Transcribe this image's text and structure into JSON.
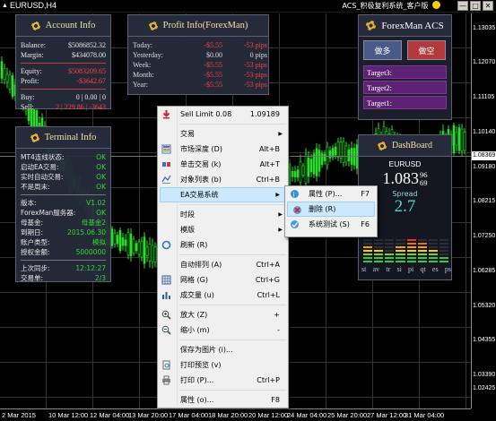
{
  "window": {
    "symbol_tab": "EURUSD,H4",
    "ea_label": "ACS_积极复利系统_客户版",
    "buttons": [
      "—",
      "□",
      "✕"
    ]
  },
  "price_axis": {
    "ticks": [
      "1.13035",
      "1.12070",
      "1.11105",
      "1.10140",
      "1.09180",
      "1.08215",
      "1.07250",
      "1.06285",
      "1.05320",
      "1.04355",
      "1.03390",
      "1.02425"
    ],
    "current": "1.08369"
  },
  "time_axis": {
    "labels": [
      "2 Mar 2015",
      "10 Mar 12:00",
      "12 Mar 04:00",
      "13 Mar 20:00",
      "17 Mar 04:00",
      "18 Mar 20:00",
      "20 Mar 12:00",
      "24 Mar 04:00",
      "25 Mar 20:00",
      "27 Mar 12:00",
      "31 Mar 04:00",
      "1 Apr 12:00",
      "6 Apr 04:00",
      "7 Apr 20:00"
    ]
  },
  "account": {
    "title": "Account Info",
    "rows": [
      {
        "label": "Balance:",
        "value": "$5086852.32"
      },
      {
        "label": "Margin:",
        "value": "$434078.00"
      },
      {
        "label": "Equity:",
        "value": "$5083209.65"
      },
      {
        "label": "Profit:",
        "value": "-$3642.67"
      },
      {
        "label": "Buy:",
        "value": "0 | 0.00 | 0"
      },
      {
        "label": "Sell:",
        "value": "2 | 229.86 | -3643"
      }
    ]
  },
  "profit": {
    "title": "Profit Info(ForexMan)",
    "rows": [
      {
        "label": "Today:",
        "amount": "-$5.55",
        "pips": "-53 pips"
      },
      {
        "label": "Yesterday:",
        "amount": "$0.00",
        "pips": "0 pips"
      },
      {
        "label": "Week:",
        "amount": "-$5.55",
        "pips": "-53 pips"
      },
      {
        "label": "Month:",
        "amount": "-$5.55",
        "pips": "-53 pips"
      },
      {
        "label": "Year:",
        "amount": "-$5.55",
        "pips": "-53 pips"
      }
    ]
  },
  "terminal": {
    "title": "Terminal Info",
    "rows1": [
      {
        "label": "MT4连线状态:",
        "value": "OK"
      },
      {
        "label": "启动EA交易:",
        "value": "OK"
      },
      {
        "label": "实时自动交易:",
        "value": "OK"
      },
      {
        "label": "不是周末:",
        "value": "OK"
      }
    ],
    "rows2": [
      {
        "label": "版本:",
        "value": "V1.02"
      },
      {
        "label": "ForexMan服务器:",
        "value": "OK"
      },
      {
        "label": "母基金:",
        "value": "母基金2"
      },
      {
        "label": "到期日:",
        "value": "2015.06.30"
      },
      {
        "label": "账户类型:",
        "value": "模拟"
      },
      {
        "label": "授权金额:",
        "value": "5000000"
      }
    ],
    "rows3": [
      {
        "label": "上次同步:",
        "value": "12:12:27"
      },
      {
        "label": "交易单:",
        "value": "2/3"
      }
    ]
  },
  "acs": {
    "title": "ForexMan ACS",
    "buy_label": "做多",
    "sell_label": "做空",
    "targets": [
      "Target3:",
      "Target2:",
      "Target1:"
    ]
  },
  "dashboard": {
    "title": "DashBoard",
    "symbol": "EURUSD",
    "price_main": "1.083",
    "price_small_top": "96",
    "price_small_bottom": "69",
    "spread_label": "Spread",
    "spread_value": "2.7",
    "days": [
      "st",
      "av",
      "tr",
      "si",
      "pi",
      "qt",
      "es",
      "ps"
    ],
    "levels": [
      0.7,
      0.6,
      0.45,
      0.7,
      1.0,
      0.8,
      0.6,
      0.35
    ]
  },
  "context_menu": {
    "items": [
      {
        "label": "Sell Limit 0.08",
        "shortcut": "1.09189",
        "icon": "sell-limit-icon"
      },
      {
        "sep": true
      },
      {
        "label": "交易",
        "arrow": true
      },
      {
        "label": "市场深度 (D)",
        "shortcut": "Alt+B",
        "icon": "market-depth-icon"
      },
      {
        "label": "单击交易 (k)",
        "shortcut": "Alt+T",
        "icon": "one-click-icon"
      },
      {
        "label": "对象列表 (b)",
        "shortcut": "Ctrl+B",
        "icon": "object-list-icon"
      },
      {
        "label": "EA交易系统",
        "arrow": true,
        "highlight": true
      },
      {
        "sep": true
      },
      {
        "label": "时段",
        "arrow": true
      },
      {
        "label": "模版",
        "arrow": true
      },
      {
        "label": "刷新 (R)",
        "icon": "refresh-icon"
      },
      {
        "sep": true
      },
      {
        "label": "自动排列 (A)",
        "shortcut": "Ctrl+A"
      },
      {
        "label": "网格 (G)",
        "shortcut": "Ctrl+G",
        "icon": "grid-icon"
      },
      {
        "label": "成交量 (u)",
        "shortcut": "Ctrl+L",
        "icon": "volume-icon"
      },
      {
        "sep": true
      },
      {
        "label": "放大 (Z)",
        "shortcut": "+",
        "icon": "zoom-in-icon"
      },
      {
        "label": "缩小 (m)",
        "shortcut": "-",
        "icon": "zoom-out-icon"
      },
      {
        "sep": true
      },
      {
        "label": "保存为图片 (i)..."
      },
      {
        "label": "打印预览 (v)",
        "icon": "print-preview-icon"
      },
      {
        "label": "打印 (P)...",
        "shortcut": "Ctrl+P",
        "icon": "print-icon"
      },
      {
        "sep": true
      },
      {
        "label": "属性 (o)...",
        "shortcut": "F8"
      }
    ]
  },
  "submenu": {
    "items": [
      {
        "label": "属性 (P)...",
        "shortcut": "F7",
        "icon": "properties-icon"
      },
      {
        "label": "删除 (R)",
        "icon": "remove-icon",
        "highlight": true
      },
      {
        "label": "系统测试 (S)",
        "shortcut": "F6",
        "icon": "tester-icon"
      }
    ]
  }
}
